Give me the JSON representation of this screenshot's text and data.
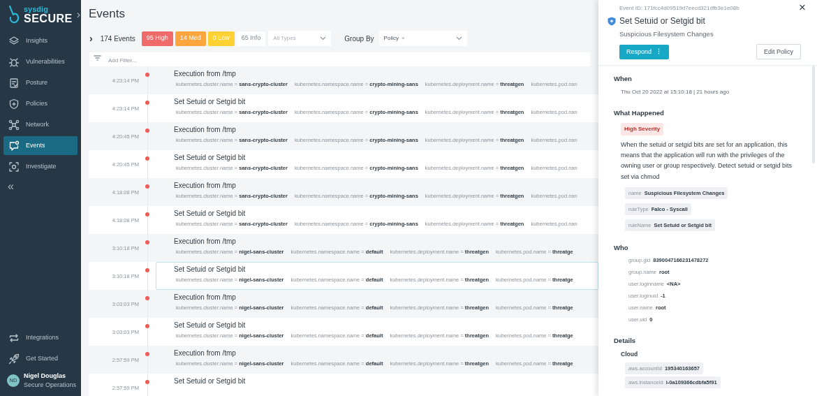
{
  "sidebar": {
    "brand": "sysdig",
    "product": "SECURE",
    "expand": "›",
    "items": [
      {
        "label": "Insights",
        "selected": false
      },
      {
        "label": "Vulnerabilities",
        "selected": false
      },
      {
        "label": "Posture",
        "selected": false
      },
      {
        "label": "Policies",
        "selected": false
      },
      {
        "label": "Network",
        "selected": false
      },
      {
        "label": "Events",
        "selected": true
      },
      {
        "label": "Investigate",
        "selected": false
      }
    ],
    "collapse": "«",
    "bottom_items": [
      {
        "label": "Integrations"
      },
      {
        "label": "Get Started"
      }
    ],
    "user": {
      "initials": "ND",
      "name": "Nigel Douglas",
      "role": "Secure Operations"
    }
  },
  "page_title": "Events",
  "toolbar": {
    "expand": "›",
    "count": "174 Events",
    "severity_counts": [
      {
        "label": "95 High",
        "kind": "high"
      },
      {
        "label": "14 Med",
        "kind": "medium"
      },
      {
        "label": "0 Low",
        "kind": "low"
      },
      {
        "label": "65 Info",
        "kind": "info"
      }
    ],
    "type_filter": {
      "placeholder": "All Types"
    },
    "group_by_label": "Group By",
    "group_by": {
      "value": "Policy",
      "remove": "×"
    }
  },
  "filter": {
    "placeholder": "Add Filter..."
  },
  "events": [
    {
      "time": "4:23:14 PM",
      "kind": "high",
      "title": "Execution from /tmp",
      "selected": false,
      "tags": [
        {
          "key": "kubernetes.cluster.name",
          "operator": "=",
          "value": "sans-crypto-cluster"
        },
        {
          "key": "kubernetes.namespace.name",
          "operator": "=",
          "value": "crypto-mining-sans"
        },
        {
          "key": "kubernetes.deployment.name",
          "operator": "=",
          "value": "threatgen"
        },
        {
          "key": "kubernetes.pod.nan"
        }
      ]
    },
    {
      "time": "4:23:14 PM",
      "kind": "high",
      "title": "Set Setuid or Setgid bit",
      "selected": false,
      "tags": [
        {
          "key": "kubernetes.cluster.name",
          "operator": "=",
          "value": "sans-crypto-cluster"
        },
        {
          "key": "kubernetes.namespace.name",
          "operator": "=",
          "value": "crypto-mining-sans"
        },
        {
          "key": "kubernetes.deployment.name",
          "operator": "=",
          "value": "threatgen"
        },
        {
          "key": "kubernetes.pod.nan"
        }
      ]
    },
    {
      "time": "4:20:45 PM",
      "kind": "high",
      "title": "Execution from /tmp",
      "selected": false,
      "tags": [
        {
          "key": "kubernetes.cluster.name",
          "operator": "=",
          "value": "sans-crypto-cluster"
        },
        {
          "key": "kubernetes.namespace.name",
          "operator": "=",
          "value": "crypto-mining-sans"
        },
        {
          "key": "kubernetes.deployment.name",
          "operator": "=",
          "value": "threatgen"
        },
        {
          "key": "kubernetes.pod.nan"
        }
      ]
    },
    {
      "time": "4:20:45 PM",
      "kind": "high",
      "title": "Set Setuid or Setgid bit",
      "selected": false,
      "tags": [
        {
          "key": "kubernetes.cluster.name",
          "operator": "=",
          "value": "sans-crypto-cluster"
        },
        {
          "key": "kubernetes.namespace.name",
          "operator": "=",
          "value": "crypto-mining-sans"
        },
        {
          "key": "kubernetes.deployment.name",
          "operator": "=",
          "value": "threatgen"
        },
        {
          "key": "kubernetes.pod.nan"
        }
      ]
    },
    {
      "time": "4:18:08 PM",
      "kind": "high",
      "title": "Execution from /tmp",
      "selected": false,
      "tags": [
        {
          "key": "kubernetes.cluster.name",
          "operator": "=",
          "value": "sans-crypto-cluster"
        },
        {
          "key": "kubernetes.namespace.name",
          "operator": "=",
          "value": "crypto-mining-sans"
        },
        {
          "key": "kubernetes.deployment.name",
          "operator": "=",
          "value": "threatgen"
        },
        {
          "key": "kubernetes.pod.nan"
        }
      ]
    },
    {
      "time": "4:18:08 PM",
      "kind": "high",
      "title": "Set Setuid or Setgid bit",
      "selected": false,
      "tags": [
        {
          "key": "kubernetes.cluster.name",
          "operator": "=",
          "value": "sans-crypto-cluster"
        },
        {
          "key": "kubernetes.namespace.name",
          "operator": "=",
          "value": "crypto-mining-sans"
        },
        {
          "key": "kubernetes.deployment.name",
          "operator": "=",
          "value": "threatgen"
        },
        {
          "key": "kubernetes.pod.nan"
        }
      ]
    },
    {
      "time": "3:10:18 PM",
      "kind": "high",
      "title": "Execution from /tmp",
      "selected": false,
      "tags": [
        {
          "key": "kubernetes.cluster.name",
          "operator": "=",
          "value": "nigel-sans-cluster"
        },
        {
          "key": "kubernetes.namespace.name",
          "operator": "=",
          "value": "default"
        },
        {
          "key": "kubernetes.deployment.name",
          "operator": "=",
          "value": "threatgen"
        },
        {
          "key": "kubernetes.pod.name",
          "operator": "=",
          "value": "threatge"
        }
      ]
    },
    {
      "time": "3:10:18 PM",
      "kind": "high",
      "title": "Set Setuid or Setgid bit",
      "selected": true,
      "tags": [
        {
          "key": "kubernetes.cluster.name",
          "operator": "=",
          "value": "nigel-sans-cluster"
        },
        {
          "key": "kubernetes.namespace.name",
          "operator": "=",
          "value": "default"
        },
        {
          "key": "kubernetes.deployment.name",
          "operator": "=",
          "value": "threatgen"
        },
        {
          "key": "kubernetes.pod.name",
          "operator": "=",
          "value": "threatge"
        }
      ]
    },
    {
      "time": "3:03:03 PM",
      "kind": "high",
      "title": "Execution from /tmp",
      "selected": false,
      "tags": [
        {
          "key": "kubernetes.cluster.name",
          "operator": "=",
          "value": "nigel-sans-cluster"
        },
        {
          "key": "kubernetes.namespace.name",
          "operator": "=",
          "value": "default"
        },
        {
          "key": "kubernetes.deployment.name",
          "operator": "=",
          "value": "threatgen"
        },
        {
          "key": "kubernetes.pod.name",
          "operator": "=",
          "value": "threatge"
        }
      ]
    },
    {
      "time": "3:03:03 PM",
      "kind": "high",
      "title": "Set Setuid or Setgid bit",
      "selected": false,
      "tags": [
        {
          "key": "kubernetes.cluster.name",
          "operator": "=",
          "value": "nigel-sans-cluster"
        },
        {
          "key": "kubernetes.namespace.name",
          "operator": "=",
          "value": "default"
        },
        {
          "key": "kubernetes.deployment.name",
          "operator": "=",
          "value": "threatgen"
        },
        {
          "key": "kubernetes.pod.name",
          "operator": "=",
          "value": "threatge"
        }
      ]
    },
    {
      "time": "2:57:59 PM",
      "kind": "high",
      "title": "Execution from /tmp",
      "selected": false,
      "tags": [
        {
          "key": "kubernetes.cluster.name",
          "operator": "=",
          "value": "nigel-sans-cluster"
        },
        {
          "key": "kubernetes.namespace.name",
          "operator": "=",
          "value": "default"
        },
        {
          "key": "kubernetes.deployment.name",
          "operator": "=",
          "value": "threatgen"
        },
        {
          "key": "kubernetes.pod.name",
          "operator": "=",
          "value": "threatge"
        }
      ]
    },
    {
      "time": "2:57:59 PM",
      "kind": "high",
      "title": "Set Setuid or Setgid bit",
      "selected": false
    }
  ],
  "detail": {
    "event_id": "Event ID: 171fcc4d09519d7eecd321dfb3e1e08b",
    "close": "×",
    "title": "Set Setuid or Setgid bit",
    "subtitle": "Suspicious Filesystem Changes",
    "respond": "Respond",
    "respond_menu": "⋮",
    "edit_policy": "Edit Policy",
    "when_heading": "When",
    "when": "Thu Oct 20 2022 at 15:10:18 | 21 hours ago",
    "what_heading": "What Happened",
    "severity_badge": "High Severity",
    "description": "When the setuid or setgid bits are set for an application, this means that the application will run with the privileges of the owning user or group respectively. Detect setuid or setgid bits set via chmod",
    "rule_fields": [
      {
        "key": "name",
        "value": "Suspicious Filesystem Changes"
      },
      {
        "key": "ruleType",
        "value": "Falco - Syscall"
      },
      {
        "key": "ruleName",
        "value": "Set Setuid or Setgid bit"
      }
    ],
    "who_heading": "Who",
    "who_fields": [
      {
        "key": "group.gid",
        "value": "8390047166231478272"
      },
      {
        "key": "group.name",
        "value": "root"
      },
      {
        "key": "user.loginname",
        "value": "<NA>"
      },
      {
        "key": "user.loginuid",
        "value": "-1"
      },
      {
        "key": "user.name",
        "value": "root"
      },
      {
        "key": "user.uid",
        "value": "0"
      }
    ],
    "details_heading": "Details",
    "cloud_heading": "Cloud",
    "cloud_fields": [
      {
        "key": "aws.accountId",
        "value": "195340163657"
      },
      {
        "key": "aws.instanceId",
        "value": "i-0a109366cdbfa5f91"
      }
    ]
  }
}
